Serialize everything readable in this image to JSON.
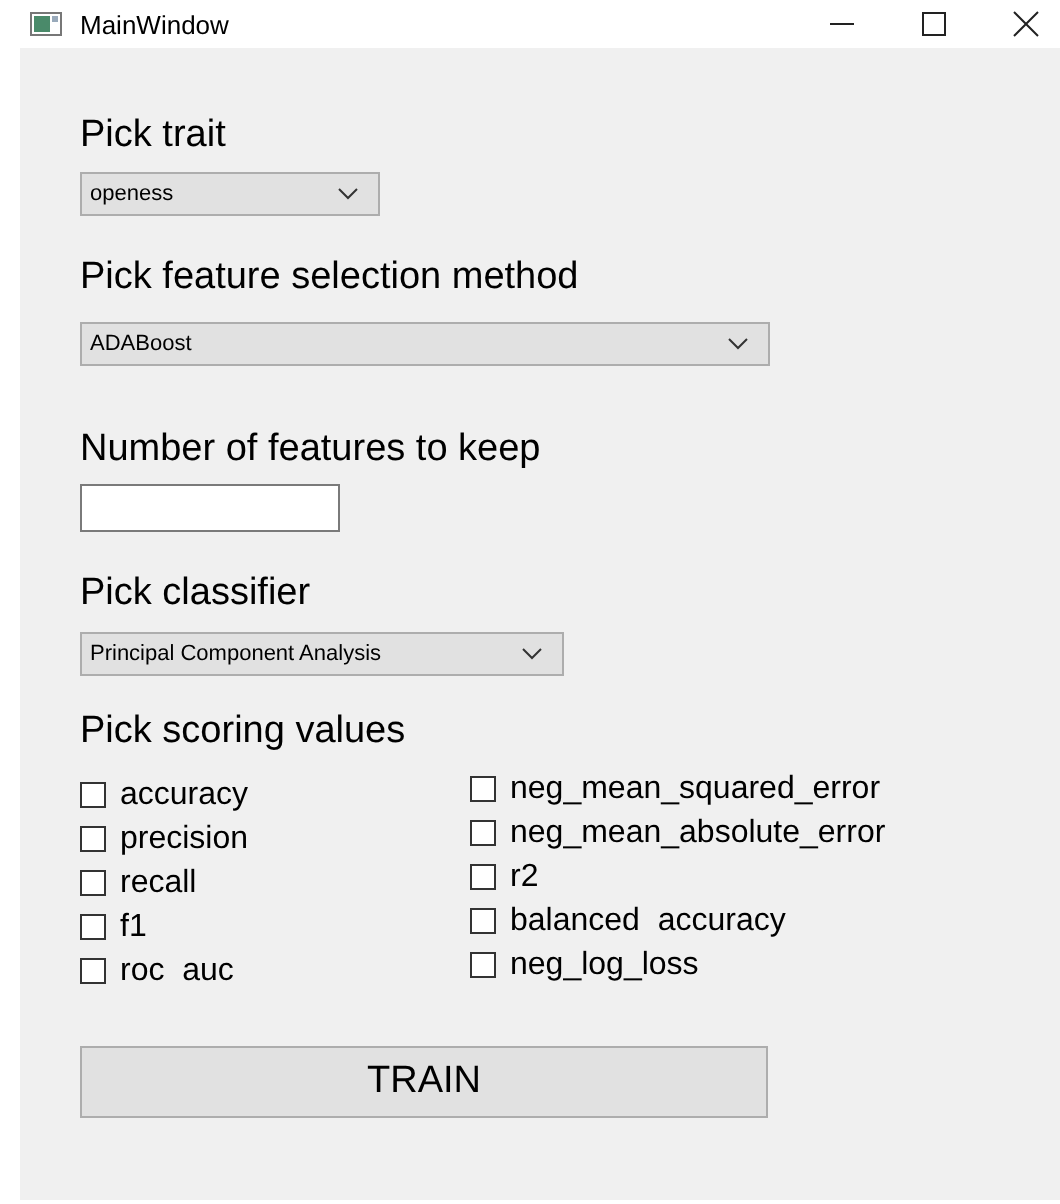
{
  "window": {
    "title": "MainWindow"
  },
  "trait": {
    "label": "Pick trait",
    "value": "openess"
  },
  "feature_selection": {
    "label": "Pick feature selection method",
    "value": "ADABoost"
  },
  "feature_count": {
    "label": "Number of features to keep"
  },
  "classifier": {
    "label": "Pick classifier",
    "value": "Principal Component Analysis"
  },
  "scoring": {
    "label": "Pick scoring values",
    "columns": [
      [
        {
          "label": "accuracy",
          "checked": false
        },
        {
          "label": "precision",
          "checked": false
        },
        {
          "label": "recall",
          "checked": false
        },
        {
          "label": "f1",
          "checked": false
        },
        {
          "label": "roc  auc",
          "checked": false
        }
      ],
      [
        {
          "label": "neg_mean_squared_error",
          "checked": false
        },
        {
          "label": "neg_mean_absolute_error",
          "checked": false
        },
        {
          "label": "r2",
          "checked": false
        },
        {
          "label": "balanced  accuracy",
          "checked": false
        },
        {
          "label": "neg_log_loss",
          "checked": false
        }
      ]
    ]
  },
  "train_button": "TRAIN"
}
